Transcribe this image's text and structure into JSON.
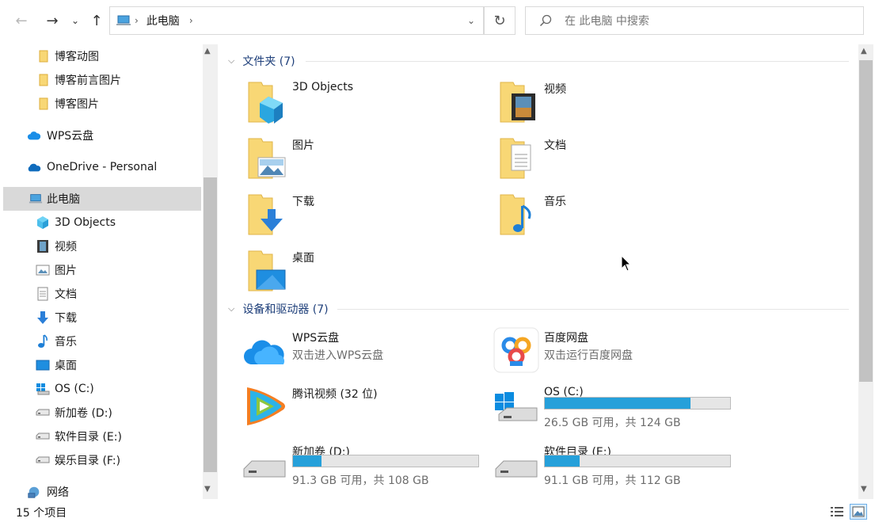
{
  "address": {
    "path": [
      "此电脑"
    ]
  },
  "search": {
    "placeholder": "在 此电脑 中搜索"
  },
  "nav": {
    "items": [
      {
        "label": "博客动图",
        "icon": "folder-icon"
      },
      {
        "label": "博客前言图片",
        "icon": "folder-icon"
      },
      {
        "label": "博客图片",
        "icon": "folder-icon"
      },
      {
        "label": "WPS云盘",
        "icon": "wps-cloud-icon"
      },
      {
        "label": "OneDrive - Personal",
        "icon": "onedrive-icon"
      },
      {
        "label": "此电脑",
        "icon": "this-pc-icon"
      },
      {
        "label": "3D Objects",
        "icon": "3d-objects-icon"
      },
      {
        "label": "视频",
        "icon": "videos-icon"
      },
      {
        "label": "图片",
        "icon": "pictures-icon"
      },
      {
        "label": "文档",
        "icon": "documents-icon"
      },
      {
        "label": "下载",
        "icon": "downloads-icon"
      },
      {
        "label": "音乐",
        "icon": "music-icon"
      },
      {
        "label": "桌面",
        "icon": "desktop-icon"
      },
      {
        "label": "OS (C:)",
        "icon": "windows-drive-icon"
      },
      {
        "label": "新加卷 (D:)",
        "icon": "drive-icon"
      },
      {
        "label": "软件目录 (E:)",
        "icon": "drive-icon"
      },
      {
        "label": "娱乐目录 (F:)",
        "icon": "drive-icon"
      },
      {
        "label": "网络",
        "icon": "network-icon"
      }
    ]
  },
  "main": {
    "folders_header": "文件夹 (7)",
    "folders": [
      {
        "label": "3D Objects",
        "icon": "3d-objects-folder-icon"
      },
      {
        "label": "视频",
        "icon": "videos-folder-icon"
      },
      {
        "label": "图片",
        "icon": "pictures-folder-icon"
      },
      {
        "label": "文档",
        "icon": "documents-folder-icon"
      },
      {
        "label": "下载",
        "icon": "downloads-folder-icon"
      },
      {
        "label": "音乐",
        "icon": "music-folder-icon"
      },
      {
        "label": "桌面",
        "icon": "desktop-folder-icon"
      }
    ],
    "devices_header": "设备和驱动器 (7)",
    "devices": [
      {
        "label": "WPS云盘",
        "sub": "双击进入WPS云盘",
        "icon": "wps-cloud-icon"
      },
      {
        "label": "百度网盘",
        "sub": "双击运行百度网盘",
        "icon": "baidu-netdisk-icon"
      },
      {
        "label": "腾讯视频 (32 位)",
        "icon": "tencent-video-icon"
      },
      {
        "label": "OS (C:)",
        "size": "26.5 GB 可用，共 124 GB",
        "used_fraction": 0.786,
        "icon": "windows-drive-icon"
      },
      {
        "label": "新加卷 (D:)",
        "size": "91.3 GB 可用，共 108 GB",
        "used_fraction": 0.155,
        "icon": "drive-icon"
      },
      {
        "label": "软件目录 (E:)",
        "size": "91.1 GB 可用，共 112 GB",
        "used_fraction": 0.187,
        "icon": "drive-icon"
      }
    ]
  },
  "status": {
    "count": "15 个项目"
  },
  "colors": {
    "accent": "#26a0da",
    "folder": "#f8d775",
    "header_text": "#1e3f7a",
    "selected_bg": "#d9d9d9"
  }
}
